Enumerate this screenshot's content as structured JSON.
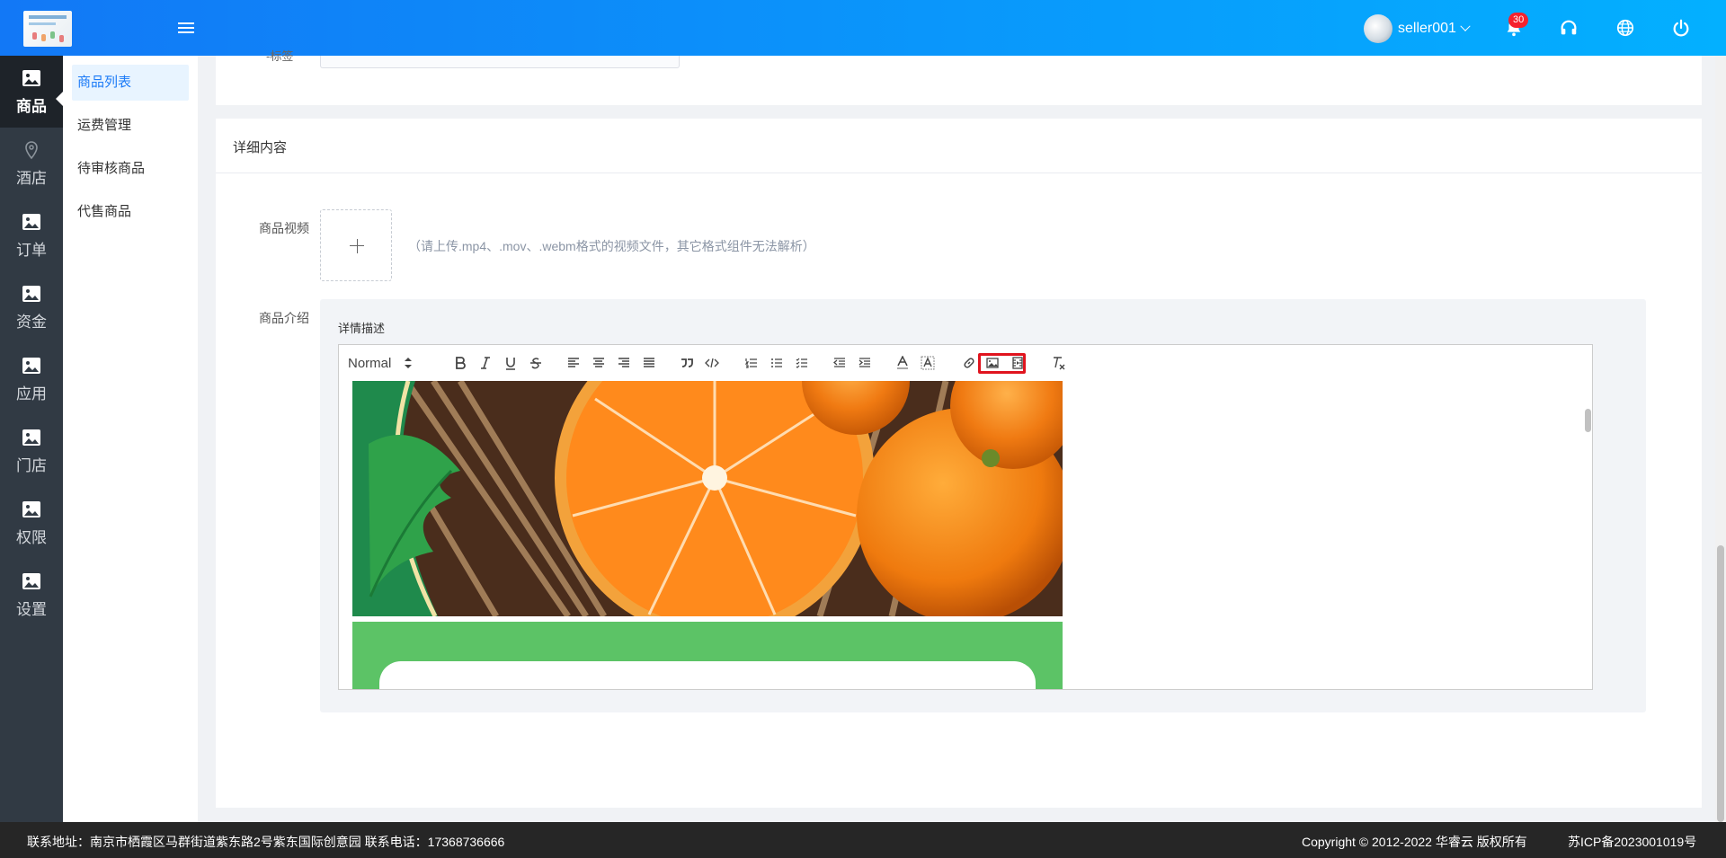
{
  "header": {
    "username": "seller001",
    "notification_count": "30"
  },
  "rail": {
    "items": [
      {
        "label": "商品"
      },
      {
        "label": "酒店"
      },
      {
        "label": "订单"
      },
      {
        "label": "资金"
      },
      {
        "label": "应用"
      },
      {
        "label": "门店"
      },
      {
        "label": "权限"
      },
      {
        "label": "设置"
      }
    ]
  },
  "submenu": {
    "items": [
      {
        "label": "商品列表"
      },
      {
        "label": "运费管理"
      },
      {
        "label": "待审核商品"
      },
      {
        "label": "代售商品"
      }
    ]
  },
  "main": {
    "truncated_label": "-标签",
    "section_title": "详细内容",
    "video_label": "商品视频",
    "video_hint": "（请上传.mp4、.mov、.webm格式的视频文件，其它格式组件无法解析）",
    "intro_label": "商品介绍",
    "editor_title": "详情描述",
    "format_select": "Normal"
  },
  "footer": {
    "address": "联系地址：南京市栖霞区马群街道紫东路2号紫东国际创意园 联系电话：17368736666",
    "copyright": "Copyright © 2012-2022 华睿云 版权所有",
    "icp": "苏ICP备2023001019号"
  },
  "colors": {
    "header_start": "#1278f6",
    "header_end": "#03b0ff",
    "rail_bg": "#313a44",
    "accent": "#1c7bf7",
    "highlight": "#e0141e",
    "footer_bg": "#262626"
  }
}
